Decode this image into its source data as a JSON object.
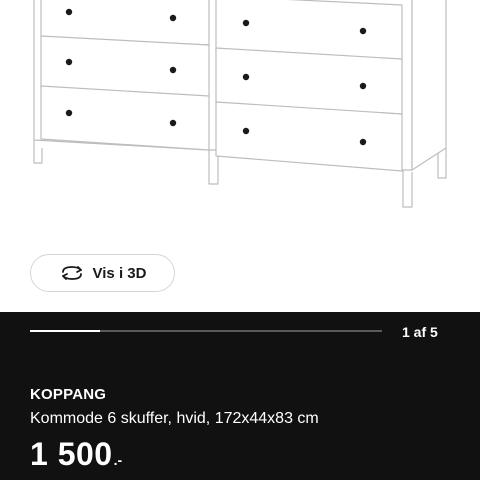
{
  "product_view": {
    "image_subject": "white dresser with 6 drawers",
    "view3d_label": "Vis i 3D",
    "view3d_icon": "rotate-3d-icon"
  },
  "gallery": {
    "progress_fraction": 0.2,
    "page_indicator": "1 af 5"
  },
  "product": {
    "name": "KOPPANG",
    "description": "Kommode 6 skuffer, hvid, 172x44x83 cm",
    "price_main": "1 500",
    "price_suffix": ".-"
  },
  "colors": {
    "panel_background": "#111111",
    "dresser_white": "#ffffff",
    "outline": "#bdbdbd",
    "knob": "#1a1a1a"
  }
}
